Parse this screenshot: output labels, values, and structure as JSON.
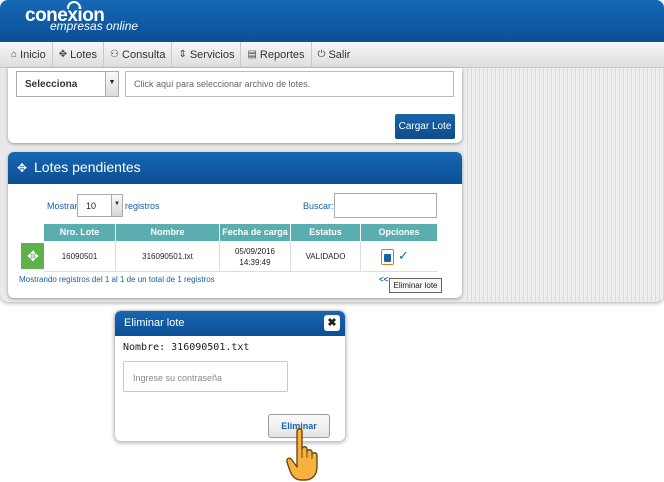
{
  "app": {
    "logo_main": "conexion",
    "logo_sub": "empresas online"
  },
  "nav": [
    {
      "label": "Inicio",
      "icon": "home-icon"
    },
    {
      "label": "Lotes",
      "icon": "puzzle-icon"
    },
    {
      "label": "Consulta",
      "icon": "people-icon"
    },
    {
      "label": "Servicios",
      "icon": "sort-icon"
    },
    {
      "label": "Reportes",
      "icon": "chart-icon"
    },
    {
      "label": "Salir",
      "icon": "power-icon"
    }
  ],
  "upload": {
    "select_value": "Selecciona",
    "file_placeholder": "Click aquí para seleccionar archivo de lotes.",
    "button_label": "Cargar Lote"
  },
  "lotes": {
    "title": "Lotes pendientes",
    "show_label": "Mostrar",
    "page_size": "10",
    "records_label": "registros",
    "search_label": "Buscar:",
    "columns": [
      "Nro. Lote",
      "Nombre",
      "Fecha de carga",
      "Estatus",
      "Opciones"
    ],
    "row": {
      "nro": "16090501",
      "nombre": "316090501.txt",
      "fecha": "05/09/2016",
      "hora": "14:39:49",
      "estatus": "VALIDADO"
    },
    "info": "Mostrando registros del 1 al 1 de un total de 1 registros",
    "pagination_first": "<<",
    "tooltip": "Eliminar lote"
  },
  "modal": {
    "title": "Eliminar lote",
    "close": "✖",
    "name_text": "Nombre: 316090501.txt",
    "password_placeholder": "Ingrese su contraseña",
    "delete_button": "Eliminar"
  },
  "colors": {
    "primary": "#0b4f97",
    "table_header": "#5aaeb0",
    "row_icon": "#5fb14a",
    "file_icon_border": "#e07a16"
  }
}
